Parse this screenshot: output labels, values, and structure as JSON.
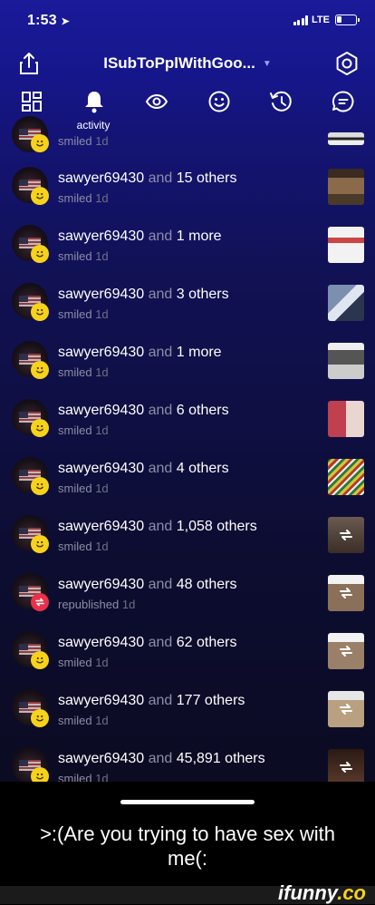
{
  "status_bar": {
    "time": "1:53",
    "network": "LTE"
  },
  "header": {
    "title": "ISubToPplWithGoo...",
    "share_icon": "share-icon",
    "settings_icon": "settings-hexagon-icon"
  },
  "tabs": {
    "items": [
      "grid-icon",
      "bell-icon",
      "eye-icon",
      "smiley-icon",
      "history-icon",
      "chat-icon"
    ],
    "active_label": "activity"
  },
  "feed": {
    "first_partial": {
      "action": "smiled",
      "age": "1d"
    },
    "rows": [
      {
        "user": "sawyer69430",
        "and": "and",
        "others": "15 others",
        "action": "smiled",
        "age": "1d",
        "badge": "smile"
      },
      {
        "user": "sawyer69430",
        "and": "and",
        "others": "1 more",
        "action": "smiled",
        "age": "1d",
        "badge": "smile"
      },
      {
        "user": "sawyer69430",
        "and": "and",
        "others": "3 others",
        "action": "smiled",
        "age": "1d",
        "badge": "smile"
      },
      {
        "user": "sawyer69430",
        "and": "and",
        "others": "1 more",
        "action": "smiled",
        "age": "1d",
        "badge": "smile"
      },
      {
        "user": "sawyer69430",
        "and": "and",
        "others": "6 others",
        "action": "smiled",
        "age": "1d",
        "badge": "smile"
      },
      {
        "user": "sawyer69430",
        "and": "and",
        "others": "4 others",
        "action": "smiled",
        "age": "1d",
        "badge": "smile"
      },
      {
        "user": "sawyer69430",
        "and": "and",
        "others": "1,058 others",
        "action": "smiled",
        "age": "1d",
        "badge": "smile"
      },
      {
        "user": "sawyer69430",
        "and": "and",
        "others": "48 others",
        "action": "republished",
        "age": "1d",
        "badge": "republish"
      },
      {
        "user": "sawyer69430",
        "and": "and",
        "others": "62 others",
        "action": "smiled",
        "age": "1d",
        "badge": "smile"
      },
      {
        "user": "sawyer69430",
        "and": "and",
        "others": "177 others",
        "action": "smiled",
        "age": "1d",
        "badge": "smile"
      },
      {
        "user": "sawyer69430",
        "and": "and",
        "others": "45,891 others",
        "action": "smiled",
        "age": "1d",
        "badge": "smile"
      }
    ]
  },
  "caption": {
    "text": ">:(Are you trying to have sex with me(:"
  },
  "watermark": {
    "brand": "ifunny",
    "suffix": ".co"
  },
  "colors": {
    "accent_smile": "#f7d21a",
    "accent_republish": "#e8314a",
    "header_bg": "#1a1a9a"
  }
}
